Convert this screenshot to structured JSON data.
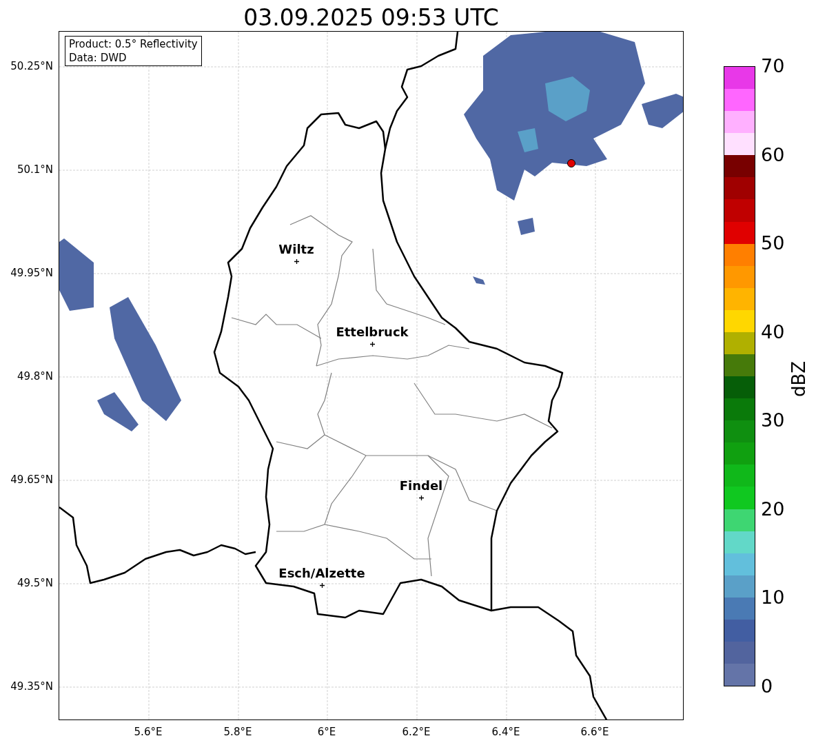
{
  "title": "03.09.2025 09:53 UTC",
  "info_box": [
    "Product: 0.5° Reflectivity",
    "Data: DWD"
  ],
  "cities": [
    {
      "label": "Wiltz"
    },
    {
      "label": "Ettelbruck"
    },
    {
      "label": "Findel"
    },
    {
      "label": "Esch/Alzette"
    }
  ],
  "x_ticks": [
    "5.6°E",
    "5.8°E",
    "6°E",
    "6.2°E",
    "6.4°E",
    "6.6°E"
  ],
  "y_ticks": [
    "50.25°N",
    "50.1°N",
    "49.95°N",
    "49.8°N",
    "49.65°N",
    "49.5°N",
    "49.35°N"
  ],
  "colorbar": {
    "label": "dBZ",
    "ticks": [
      "70",
      "60",
      "50",
      "40",
      "30",
      "20",
      "10",
      "0"
    ],
    "bands": [
      {
        "color": "#e838e8"
      },
      {
        "color": "#ff66ff"
      },
      {
        "color": "#ffb0ff"
      },
      {
        "color": "#ffe0ff"
      },
      {
        "color": "#780000"
      },
      {
        "color": "#a00000"
      },
      {
        "color": "#c00000"
      },
      {
        "color": "#e00000"
      },
      {
        "color": "#ff7f00"
      },
      {
        "color": "#ff9800"
      },
      {
        "color": "#ffb400"
      },
      {
        "color": "#ffd700"
      },
      {
        "color": "#b0b000"
      },
      {
        "color": "#467a0a"
      },
      {
        "color": "#065e08"
      },
      {
        "color": "#0a7a0a"
      },
      {
        "color": "#0f8f10"
      },
      {
        "color": "#10a010"
      },
      {
        "color": "#10b81a"
      },
      {
        "color": "#10c820"
      },
      {
        "color": "#3ed672"
      },
      {
        "color": "#62d8c8"
      },
      {
        "color": "#62bfdc"
      },
      {
        "color": "#5aa0c8"
      },
      {
        "color": "#4a7ab4"
      },
      {
        "color": "#425ea2"
      },
      {
        "color": "#52649e"
      },
      {
        "color": "#6474a8"
      }
    ]
  }
}
